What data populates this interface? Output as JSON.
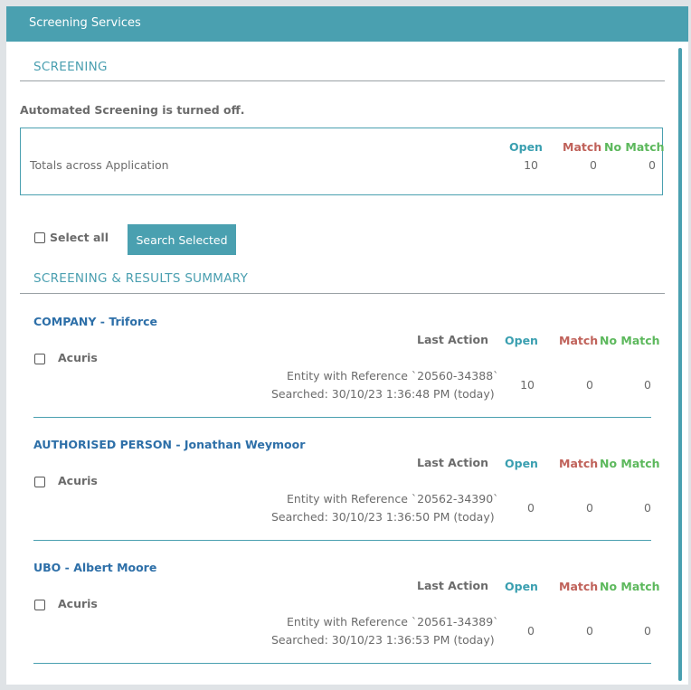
{
  "window": {
    "title": "Screening Services"
  },
  "screening": {
    "heading": "SCREENING",
    "status": "Automated Screening is turned off.",
    "totals": {
      "label": "Totals across Application",
      "open_label": "Open",
      "match_label": "Match",
      "nomatch_label": "No Match",
      "open": "10",
      "match": "0",
      "nomatch": "0"
    }
  },
  "controls": {
    "select_all_label": "Select all",
    "search_button": "Search Selected"
  },
  "summary": {
    "heading": "SCREENING & RESULTS SUMMARY",
    "columns": {
      "last_action": "Last Action",
      "open": "Open",
      "match": "Match",
      "nomatch": "No Match"
    },
    "entities": [
      {
        "title": "COMPANY - Triforce",
        "provider": "Acuris",
        "reference": "Entity with Reference `20560-34388`",
        "searched": "Searched: 30/10/23 1:36:48 PM (today)",
        "open": "10",
        "match": "0",
        "nomatch": "0"
      },
      {
        "title": "AUTHORISED PERSON - Jonathan Weymoor",
        "provider": "Acuris",
        "reference": "Entity with Reference `20562-34390`",
        "searched": "Searched: 30/10/23 1:36:50 PM (today)",
        "open": "0",
        "match": "0",
        "nomatch": "0"
      },
      {
        "title": "UBO - Albert Moore",
        "provider": "Acuris",
        "reference": "Entity with Reference `20561-34389`",
        "searched": "Searched: 30/10/23 1:36:53 PM (today)",
        "open": "0",
        "match": "0",
        "nomatch": "0"
      }
    ]
  },
  "colors": {
    "accent": "#4aa0b0",
    "match": "#c0625a",
    "nomatch": "#5cb85c",
    "link": "#2d6fa8"
  }
}
